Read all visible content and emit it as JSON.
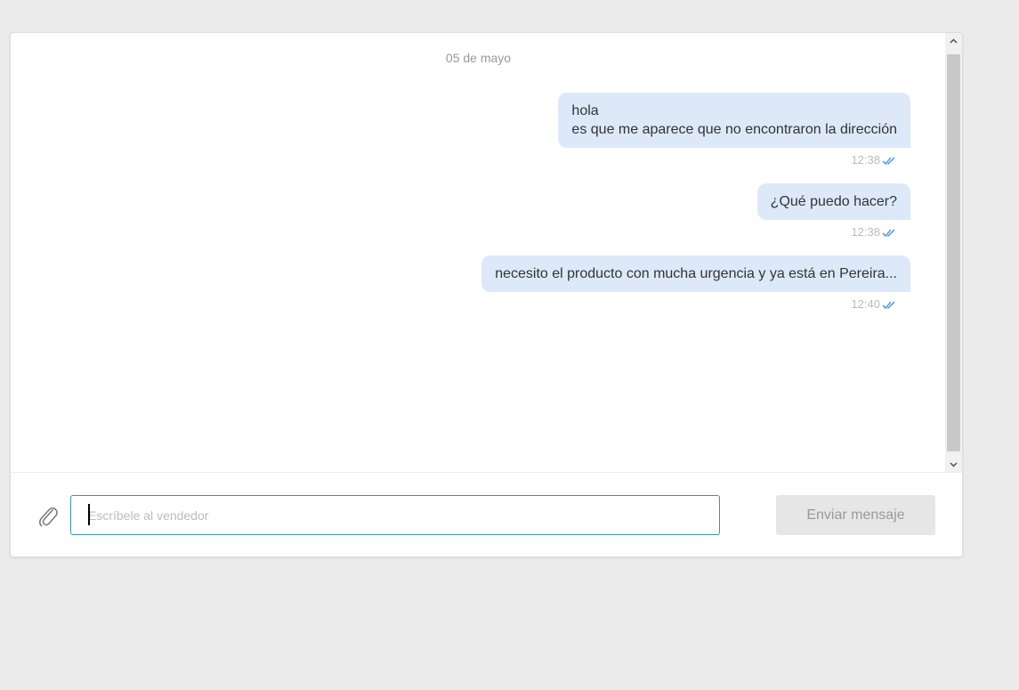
{
  "chat": {
    "date": "05 de mayo",
    "messages": [
      {
        "lines": [
          "hola",
          "es que me aparece que no encontraron la dirección"
        ],
        "time": "12:38",
        "status": "read"
      },
      {
        "lines": [
          "¿Qué puedo hacer?"
        ],
        "time": "12:38",
        "status": "read"
      },
      {
        "lines": [
          "necesito el producto con mucha urgencia y ya está en Pereira..."
        ],
        "time": "12:40",
        "status": "read"
      }
    ]
  },
  "composer": {
    "placeholder": "Escríbele al vendedor",
    "value": "",
    "send_label": "Enviar mensaje",
    "attach_icon": "paperclip-icon"
  },
  "colors": {
    "background": "#ebebeb",
    "bubble": "#dde9f9",
    "check": "#3b8ad9",
    "input_border": "#3a8fb7",
    "button_bg": "#e6e6e6"
  }
}
